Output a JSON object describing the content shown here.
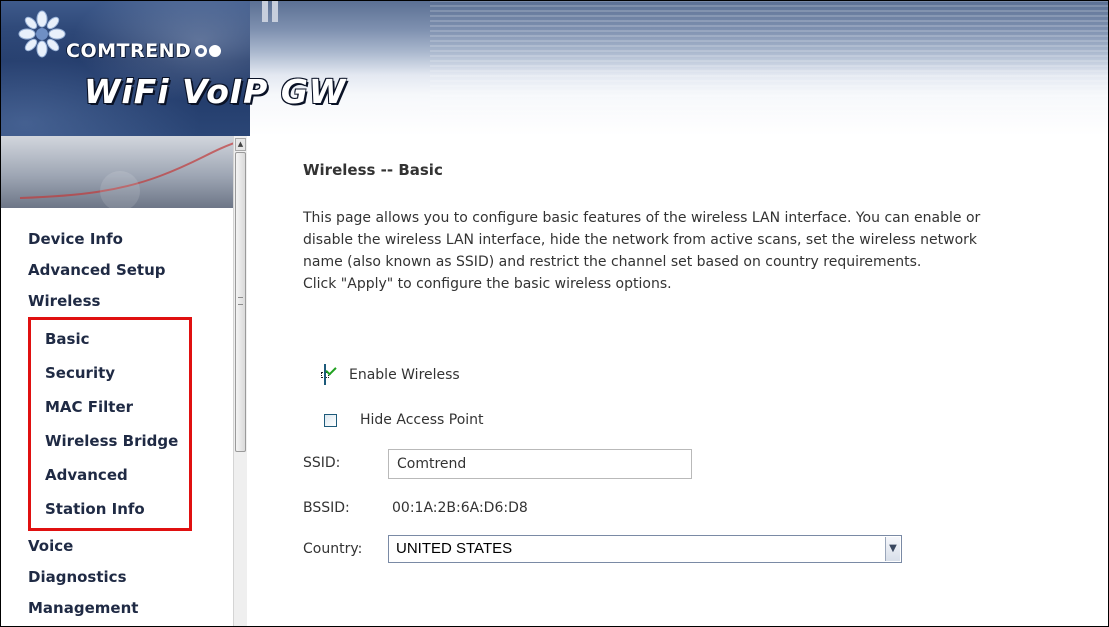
{
  "header": {
    "brand": "COMTREND",
    "product": "WiFi VoIP GW"
  },
  "sidebar": {
    "items": [
      {
        "label": "Device Info"
      },
      {
        "label": "Advanced Setup"
      },
      {
        "label": "Wireless"
      }
    ],
    "wireless_subitems": [
      {
        "label": "Basic"
      },
      {
        "label": "Security"
      },
      {
        "label": "MAC Filter"
      },
      {
        "label": "Wireless Bridge"
      },
      {
        "label": "Advanced"
      },
      {
        "label": "Station Info"
      }
    ],
    "items_after": [
      {
        "label": "Voice"
      },
      {
        "label": "Diagnostics"
      },
      {
        "label": "Management"
      }
    ]
  },
  "main": {
    "title": "Wireless -- Basic",
    "description_1": "This page allows you to configure basic features of the wireless LAN interface. You can enable or disable the wireless LAN interface, hide the network from active scans, set the wireless network name (also known as SSID) and restrict the channel set based on country requirements.",
    "description_2": "Click \"Apply\" to configure the basic wireless options.",
    "enable_wireless": {
      "label": "Enable Wireless",
      "checked": true
    },
    "hide_access_point": {
      "label": "Hide Access Point",
      "checked": false
    },
    "ssid": {
      "label": "SSID:",
      "value": "Comtrend"
    },
    "bssid": {
      "label": "BSSID:",
      "value": "00:1A:2B:6A:D6:D8"
    },
    "country": {
      "label": "Country:",
      "selected": "UNITED STATES"
    }
  },
  "colors": {
    "highlight_border": "#e01010",
    "nav_text": "#1f2a44",
    "check_green": "#21a121"
  }
}
